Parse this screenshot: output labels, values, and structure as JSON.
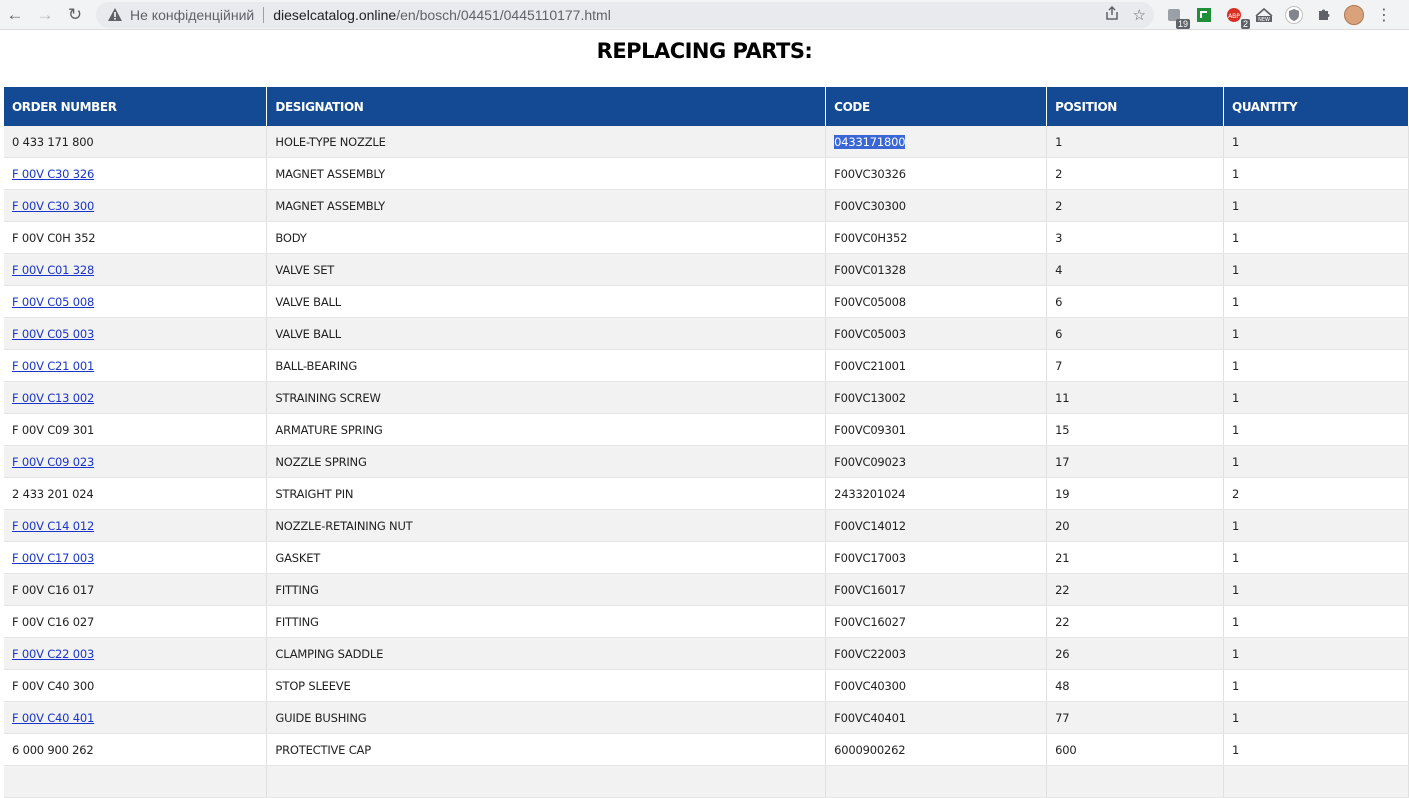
{
  "browser": {
    "insecure_label": "Не конфіденційний",
    "url_host": "dieselcatalog.online",
    "url_path": "/en/bosch/04451/0445110177.html",
    "extensions": [
      {
        "name": "reader-icon",
        "badge": "19"
      },
      {
        "name": "green-ext-icon",
        "badge": ""
      },
      {
        "name": "abp-icon",
        "badge": "2"
      },
      {
        "name": "new-ext-icon",
        "badge": ""
      },
      {
        "name": "shield-ext-icon",
        "badge": ""
      },
      {
        "name": "puzzle-icon",
        "badge": ""
      }
    ]
  },
  "page": {
    "title": "REPLACING PARTS:"
  },
  "table": {
    "headers": [
      "ORDER NUMBER",
      "DESIGNATION",
      "CODE",
      "POSITION",
      "QUANTITY"
    ],
    "rows": [
      {
        "order": "0 433 171 800",
        "link": false,
        "designation": "HOLE-TYPE NOZZLE",
        "code": "0433171800",
        "position": "1",
        "quantity": "1",
        "selected": true
      },
      {
        "order": "F 00V C30 326",
        "link": true,
        "designation": "MAGNET ASSEMBLY",
        "code": "F00VC30326",
        "position": "2",
        "quantity": "1"
      },
      {
        "order": "F 00V C30 300",
        "link": true,
        "designation": "MAGNET ASSEMBLY",
        "code": "F00VC30300",
        "position": "2",
        "quantity": "1"
      },
      {
        "order": "F 00V C0H 352",
        "link": false,
        "designation": "BODY",
        "code": "F00VC0H352",
        "position": "3",
        "quantity": "1"
      },
      {
        "order": "F 00V C01 328",
        "link": true,
        "designation": "VALVE SET",
        "code": "F00VC01328",
        "position": "4",
        "quantity": "1"
      },
      {
        "order": "F 00V C05 008",
        "link": true,
        "designation": "VALVE BALL",
        "code": "F00VC05008",
        "position": "6",
        "quantity": "1"
      },
      {
        "order": "F 00V C05 003",
        "link": true,
        "designation": "VALVE BALL",
        "code": "F00VC05003",
        "position": "6",
        "quantity": "1"
      },
      {
        "order": "F 00V C21 001",
        "link": true,
        "designation": "BALL-BEARING",
        "code": "F00VC21001",
        "position": "7",
        "quantity": "1"
      },
      {
        "order": "F 00V C13 002",
        "link": true,
        "designation": "STRAINING SCREW",
        "code": "F00VC13002",
        "position": "11",
        "quantity": "1"
      },
      {
        "order": "F 00V C09 301",
        "link": false,
        "designation": "ARMATURE SPRING",
        "code": "F00VC09301",
        "position": "15",
        "quantity": "1"
      },
      {
        "order": "F 00V C09 023",
        "link": true,
        "designation": "NOZZLE SPRING",
        "code": "F00VC09023",
        "position": "17",
        "quantity": "1"
      },
      {
        "order": "2 433 201 024",
        "link": false,
        "designation": "STRAIGHT PIN",
        "code": "2433201024",
        "position": "19",
        "quantity": "2"
      },
      {
        "order": "F 00V C14 012",
        "link": true,
        "designation": "NOZZLE-RETAINING NUT",
        "code": "F00VC14012",
        "position": "20",
        "quantity": "1"
      },
      {
        "order": "F 00V C17 003",
        "link": true,
        "designation": "GASKET",
        "code": "F00VC17003",
        "position": "21",
        "quantity": "1"
      },
      {
        "order": "F 00V C16 017",
        "link": false,
        "designation": "FITTING",
        "code": "F00VC16017",
        "position": "22",
        "quantity": "1"
      },
      {
        "order": "F 00V C16 027",
        "link": false,
        "designation": "FITTING",
        "code": "F00VC16027",
        "position": "22",
        "quantity": "1"
      },
      {
        "order": "F 00V C22 003",
        "link": true,
        "designation": "CLAMPING SADDLE",
        "code": "F00VC22003",
        "position": "26",
        "quantity": "1"
      },
      {
        "order": "F 00V C40 300",
        "link": false,
        "designation": "STOP SLEEVE",
        "code": "F00VC40300",
        "position": "48",
        "quantity": "1"
      },
      {
        "order": "F 00V C40 401",
        "link": true,
        "designation": "GUIDE BUSHING",
        "code": "F00VC40401",
        "position": "77",
        "quantity": "1"
      },
      {
        "order": "6 000 900 262",
        "link": false,
        "designation": "PROTECTIVE CAP",
        "code": "6000900262",
        "position": "600",
        "quantity": "1"
      },
      {
        "order": "",
        "link": false,
        "designation": "",
        "code": "",
        "position": "",
        "quantity": ""
      }
    ]
  },
  "colors": {
    "header_bg": "#134a93",
    "link": "#1a35c9",
    "row_alt": "#f2f2f2",
    "selection": "#3967d6"
  }
}
